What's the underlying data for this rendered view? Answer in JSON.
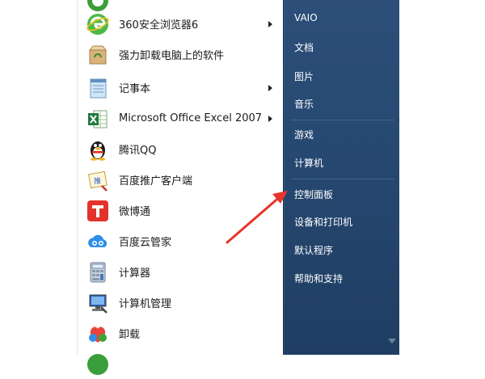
{
  "programs": [
    {
      "label": "",
      "icon": "green-app-icon",
      "has_submenu": false
    },
    {
      "label": "360安全浏览器6",
      "icon": "browser-360-icon",
      "has_submenu": true
    },
    {
      "label": "强力卸载电脑上的软件",
      "icon": "uninstall-box-icon",
      "has_submenu": false
    },
    {
      "label": "记事本",
      "icon": "notepad-icon",
      "has_submenu": true
    },
    {
      "label": "Microsoft Office Excel 2007",
      "icon": "excel-icon",
      "has_submenu": true
    },
    {
      "label": "腾讯QQ",
      "icon": "qq-penguin-icon",
      "has_submenu": false
    },
    {
      "label": "百度推广客户端",
      "icon": "baidu-promo-icon",
      "has_submenu": false
    },
    {
      "label": "微博通",
      "icon": "weibotong-icon",
      "has_submenu": false
    },
    {
      "label": "百度云管家",
      "icon": "baidu-cloud-icon",
      "has_submenu": false
    },
    {
      "label": "计算器",
      "icon": "calculator-icon",
      "has_submenu": false
    },
    {
      "label": "计算机管理",
      "icon": "computer-management-icon",
      "has_submenu": false
    },
    {
      "label": "卸载",
      "icon": "uninstall-icon",
      "has_submenu": false
    }
  ],
  "right_panel": [
    {
      "label": "VAIO"
    },
    {
      "label": "文档"
    },
    {
      "label": "图片"
    },
    {
      "label": "音乐"
    },
    {
      "label": "游戏"
    },
    {
      "label": "计算机"
    },
    {
      "label": "控制面板"
    },
    {
      "label": "设备和打印机"
    },
    {
      "label": "默认程序"
    },
    {
      "label": "帮助和支持"
    }
  ],
  "annotation": {
    "arrow_color": "#e8342a",
    "target": "控制面板"
  },
  "colors": {
    "start_panel": "#274a73",
    "right_text": "#ffffff",
    "left_text": "#1b1b1b"
  }
}
